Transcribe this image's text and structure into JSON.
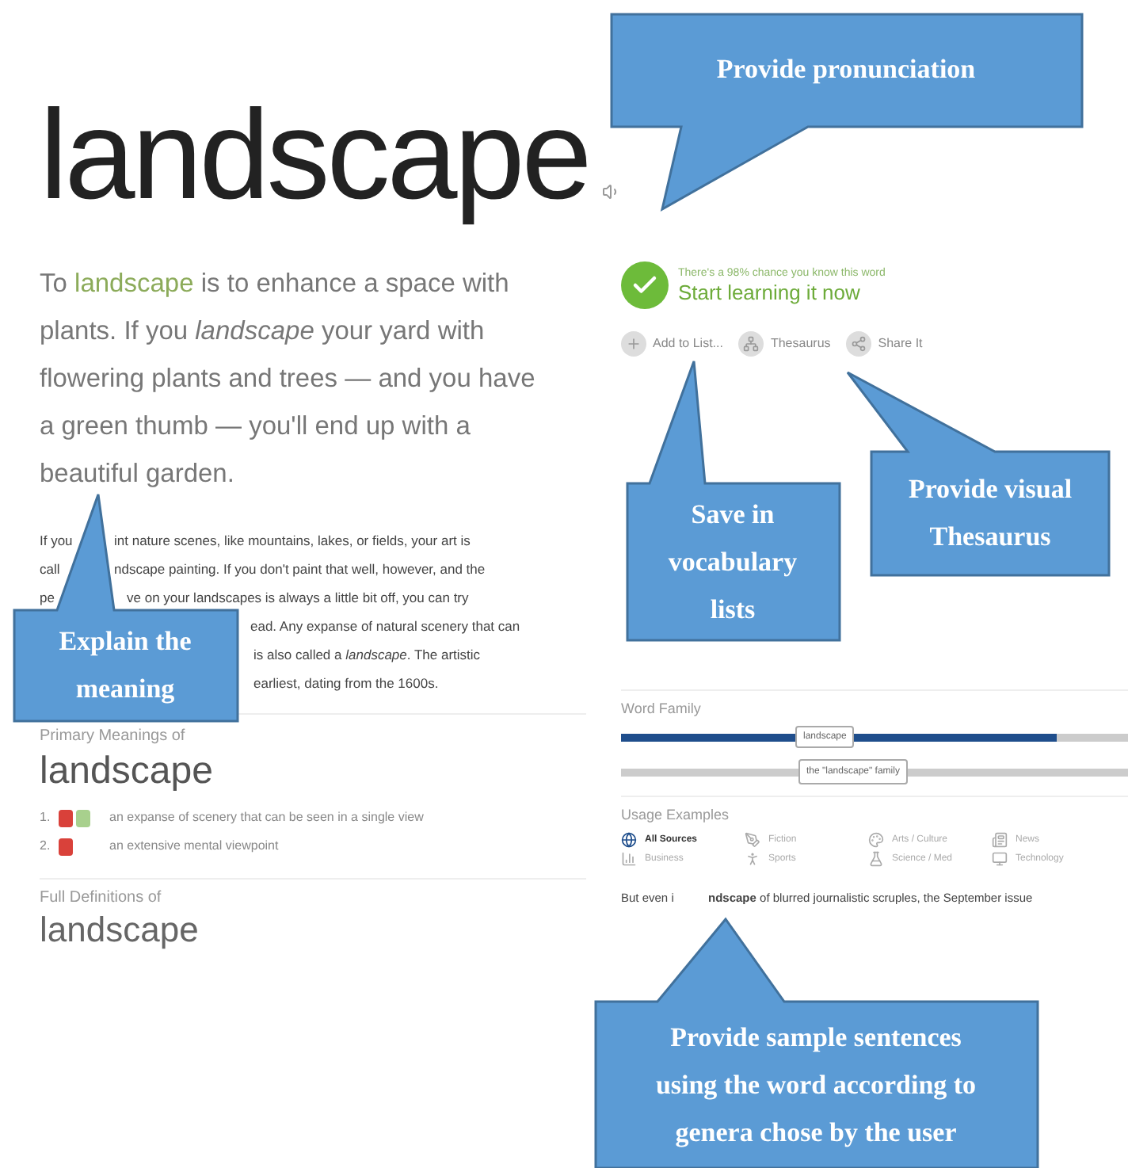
{
  "word": "landscape",
  "intro": {
    "prefix": "To",
    "link": "landscape",
    "rest": "is to enhance a space with plants. If you *landscape* your yard with flowering plants and trees — and you have a green thumb — you'll end up with a beautiful garden."
  },
  "detail_lines": [
    {
      "left": "If you",
      "right": "int nature scenes, like mountains, lakes, or fields, your art is"
    },
    {
      "left": "call",
      "right": "ndscape painting. If you don't paint that well, however, and the"
    },
    {
      "left": "pe",
      "right": "ve on your landscapes is always a little bit off, you can try"
    },
    {
      "right": "ead. Any expanse of natural scenery that can"
    },
    {
      "right": "is also called a *landscape*. The artistic"
    },
    {
      "right": "earliest, dating from the 1600s."
    }
  ],
  "learn": {
    "chance": "There's a 98% chance you know this word",
    "action": "Start learning it now"
  },
  "actions": [
    "Add to List...",
    "Thesaurus",
    "Share It"
  ],
  "primary": {
    "heading": "Primary Meanings of",
    "word": "landscape",
    "meanings": [
      {
        "number": "1.",
        "badges": [
          {
            "color": "#d9413a"
          },
          {
            "color": "#a8d08d"
          }
        ],
        "text": "an expanse of scenery that can be seen in a single view"
      },
      {
        "number": "2.",
        "badges": [
          {
            "color": "#d9413a"
          }
        ],
        "text": "an extensive mental viewpoint"
      }
    ]
  },
  "full": {
    "heading": "Full Definitions of",
    "word": "landscape"
  },
  "word_family": {
    "heading": "Word Family",
    "word_label": "landscape",
    "family_label": "the \"landscape\" family",
    "level": 0.86
  },
  "usage": {
    "heading": "Usage Examples",
    "categories": [
      {
        "label": "All Sources",
        "kind": "globe",
        "selected": true
      },
      {
        "label": "Fiction",
        "kind": "pen",
        "selected": false
      },
      {
        "label": "Arts / Culture",
        "kind": "palette",
        "selected": false
      },
      {
        "label": "News",
        "kind": "news",
        "selected": false
      },
      {
        "label": "Business",
        "kind": "chart",
        "selected": false
      },
      {
        "label": "Sports",
        "kind": "person",
        "selected": false
      },
      {
        "label": "Science / Med",
        "kind": "flask",
        "selected": false
      },
      {
        "label": "Technology",
        "kind": "monitor",
        "selected": false
      }
    ],
    "example_left": "But even i",
    "example_right": "**ndscape** of blurred journalistic scruples, the September issue"
  },
  "callouts": [
    {
      "lines": [
        "Provide pronunciation"
      ]
    },
    {
      "lines": [
        "Explain the",
        "meaning"
      ]
    },
    {
      "lines": [
        "Save in",
        "vocabulary",
        "lists"
      ]
    },
    {
      "lines": [
        "Provide visual",
        "Thesaurus"
      ]
    },
    {
      "lines": [
        "Provide sample sentences",
        "using the word according to",
        "genera chose by the user"
      ]
    }
  ]
}
